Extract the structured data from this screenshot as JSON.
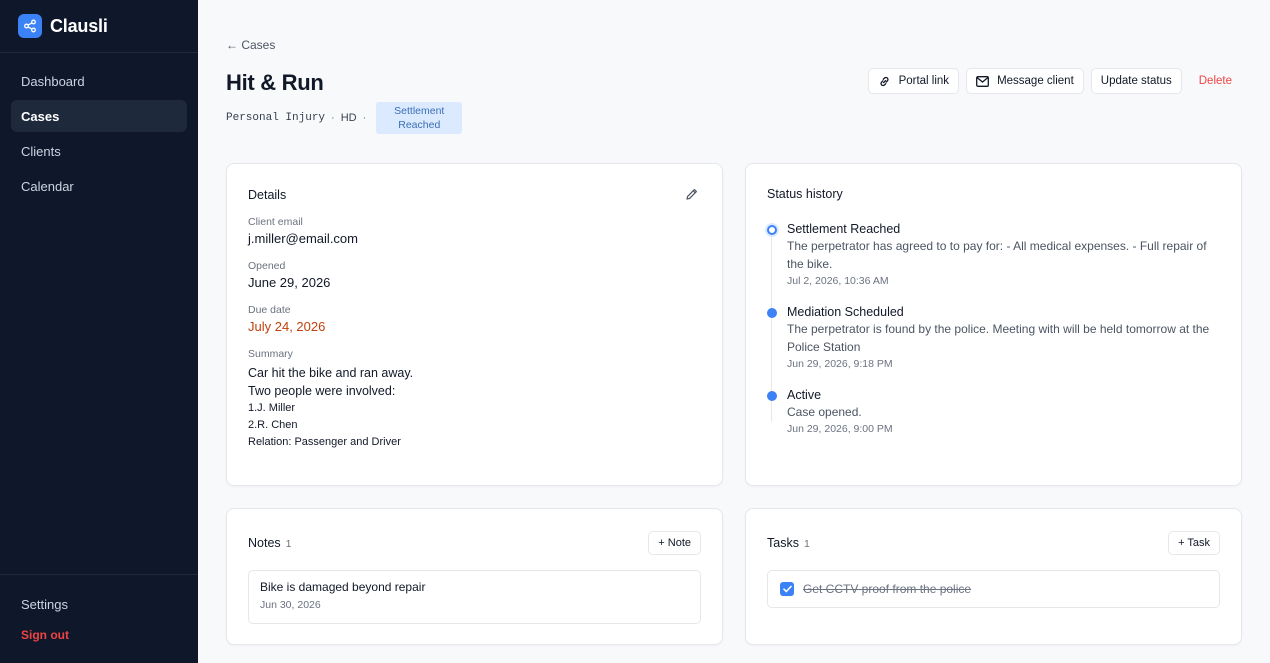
{
  "brand": {
    "name": "Clausli"
  },
  "nav": [
    {
      "label": "Dashboard"
    },
    {
      "label": "Cases"
    },
    {
      "label": "Clients"
    },
    {
      "label": "Calendar"
    }
  ],
  "sidebar_footer": {
    "settings": "Settings",
    "sign_out": "Sign out"
  },
  "breadcrumb": {
    "back": "← Cases"
  },
  "case": {
    "title": "Hit & Run",
    "type": "Personal Injury",
    "separator": "·",
    "initials": "HD",
    "status_line1": "Settlement",
    "status_line2": "Reached"
  },
  "actions": {
    "portal_link": "Portal link",
    "message_client": "Message client",
    "update_status": "Update status",
    "delete": "Delete"
  },
  "details": {
    "title": "Details",
    "client_email_label": "Client email",
    "client_email": "j.miller@email.com",
    "opened_label": "Opened",
    "opened": "June 29, 2026",
    "due_label": "Due date",
    "due": "July 24, 2026",
    "summary_label": "Summary",
    "summary_line1": "Car hit the bike and ran away.",
    "summary_line2": "Two people were involved:",
    "summary_line3": "1.J. Miller",
    "summary_line4": "2.R. Chen",
    "summary_line5": "Relation: Passenger and Driver"
  },
  "history": {
    "title": "Status history",
    "items": [
      {
        "status": "Settlement Reached",
        "note": "The perpetrator has agreed to to pay for: - All medical expenses. - Full repair of the bike.",
        "time": "Jul 2, 2026, 10:36 AM"
      },
      {
        "status": "Mediation Scheduled",
        "note": "The perpetrator is found by the police. Meeting with will be held tomorrow at the Police Station",
        "time": "Jun 29, 2026, 9:18 PM"
      },
      {
        "status": "Active",
        "note": "Case opened.",
        "time": "Jun 29, 2026, 9:00 PM"
      }
    ]
  },
  "notes": {
    "title": "Notes",
    "count": "1",
    "add_label": "+ Note",
    "items": [
      {
        "text": "Bike is damaged beyond repair",
        "date": "Jun 30, 2026"
      }
    ]
  },
  "tasks": {
    "title": "Tasks",
    "count": "1",
    "add_label": "+ Task",
    "items": [
      {
        "text": "Get CCTV proof from the police",
        "done": true
      }
    ]
  },
  "colors": {
    "accent": "#3b82f6",
    "danger": "#ef4444",
    "due": "#c2410c",
    "sidebar": "#0f172a"
  }
}
